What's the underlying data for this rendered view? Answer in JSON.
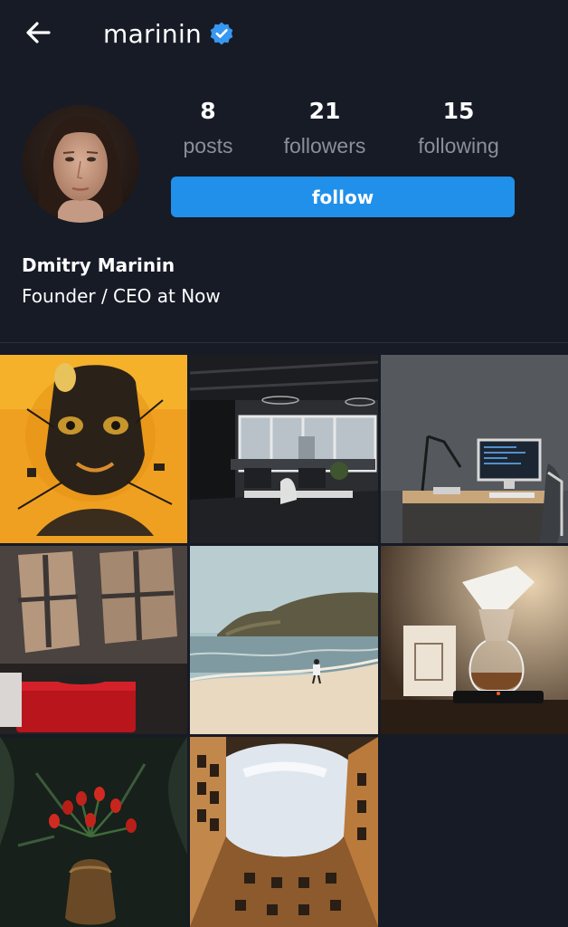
{
  "header": {
    "back_icon": "arrow-left-icon",
    "username": "marinin",
    "verified_icon": "verified-badge-icon",
    "verified_color": "#3897f0"
  },
  "profile": {
    "avatar_icon": "profile-avatar",
    "stats": [
      {
        "value": "8",
        "label": "posts"
      },
      {
        "value": "21",
        "label": "followers"
      },
      {
        "value": "15",
        "label": "following"
      }
    ],
    "follow_label": "follow",
    "follow_color": "#2190ea",
    "display_name": "Dmitry Marinin",
    "bio": "Founder / CEO at Now"
  },
  "posts": [
    {
      "subject": "orange-mechanical-face"
    },
    {
      "subject": "open-plan-office"
    },
    {
      "subject": "desk-with-monitor"
    },
    {
      "subject": "shadow-room-red-box"
    },
    {
      "subject": "beach-shore"
    },
    {
      "subject": "coffee-chemex"
    },
    {
      "subject": "red-tulips"
    },
    {
      "subject": "building-courtyard-sky"
    }
  ],
  "colors": {
    "background": "#161b26",
    "muted_text": "#8a8f98"
  }
}
